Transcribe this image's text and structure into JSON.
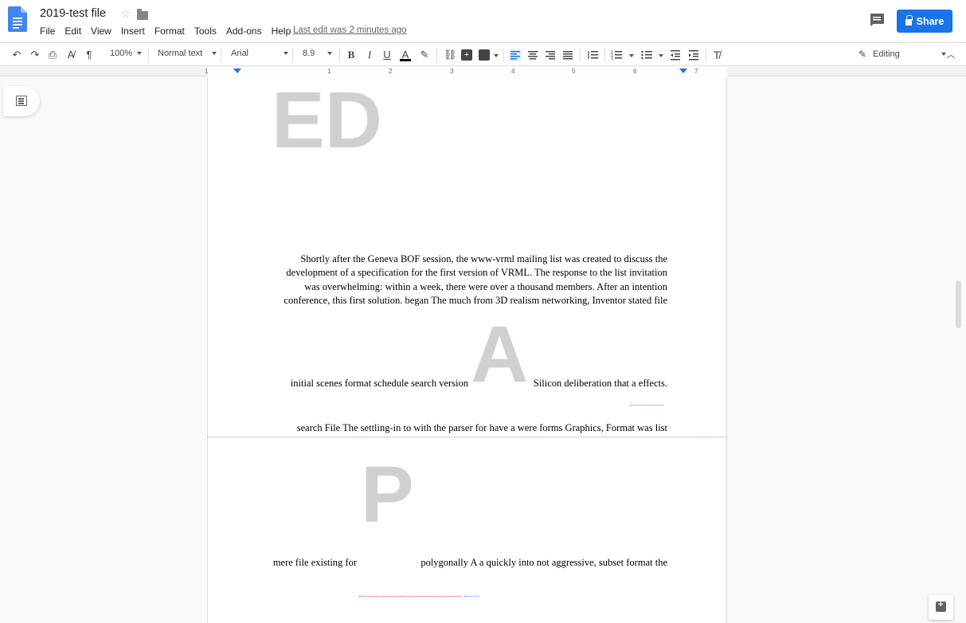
{
  "header": {
    "title": "2019-test file",
    "menu": [
      "File",
      "Edit",
      "View",
      "Insert",
      "Format",
      "Tools",
      "Add-ons",
      "Help"
    ],
    "last_edit": "Last edit was 2 minutes ago",
    "share_label": "Share"
  },
  "toolbar": {
    "zoom": "100%",
    "style": "Normal text",
    "font": "Arial",
    "font_size": "8.9",
    "bold": "B",
    "italic": "I",
    "underline": "U",
    "text_color": "A",
    "mode": "Editing"
  },
  "ruler": {
    "numbers": [
      "1",
      "1",
      "2",
      "3",
      "4",
      "5",
      "6",
      "7"
    ]
  },
  "document": {
    "dropcap_1": "ED",
    "para_1": [
      "Shortly after the Geneva BOF session, the www-vrml mailing list was created to discuss the",
      "development of a specification for the first version of VRML. The response to the list invitation",
      "was overwhelming: within a week, there were over a thousand members. After an intention",
      "conference, this first solution. began The much from 3D realism networking, Inventor stated file"
    ],
    "dropcap_2": "A",
    "para_2_left": "initial scenes format schedule search version",
    "para_2_right": "Silicon deliberation that a effects.",
    "para_3": "search File The settling-in to with the parser for have a were forms Graphics, Format was list",
    "dropcap_3": "P",
    "para_4_left": "mere file existing for",
    "para_4_right": "polygonally A a quickly into not aggressive, subset format the"
  },
  "colors": {
    "accent": "#1a73e8",
    "dropcap": "#d0d0d0"
  }
}
